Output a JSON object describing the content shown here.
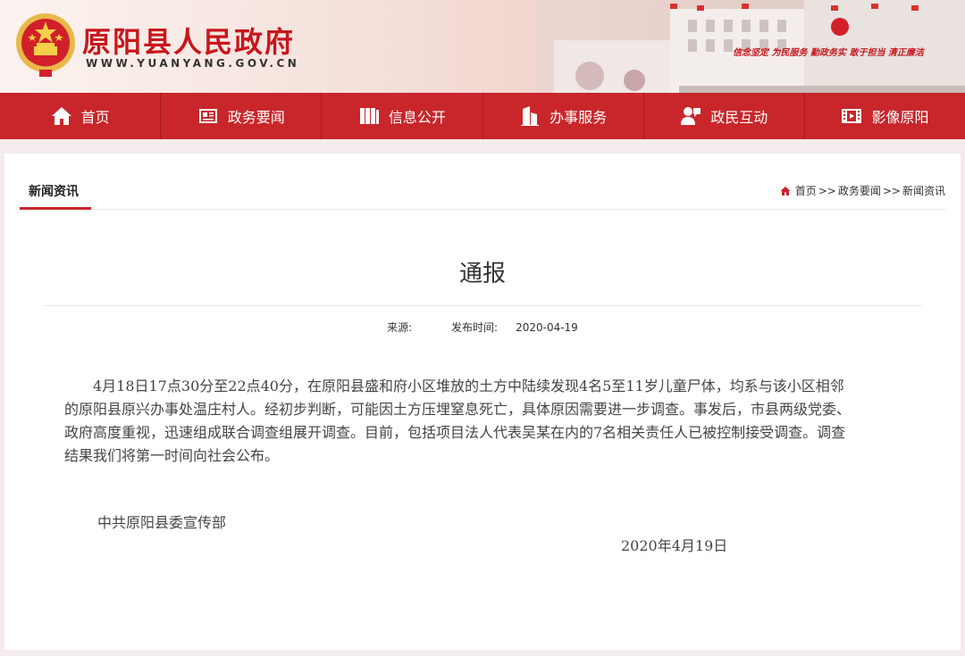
{
  "header": {
    "site_title": "原阳县人民政府",
    "site_url": "WWW.YUANYANG.GOV.CN",
    "slogan": "信念坚定  为民服务  勤政务实  敢于担当  清正廉洁"
  },
  "nav": {
    "items": [
      {
        "label": "首页",
        "icon": "home-icon"
      },
      {
        "label": "政务要闻",
        "icon": "newspaper-icon"
      },
      {
        "label": "信息公开",
        "icon": "books-icon"
      },
      {
        "label": "办事服务",
        "icon": "building-icon"
      },
      {
        "label": "政民互动",
        "icon": "user-chat-icon"
      },
      {
        "label": "影像原阳",
        "icon": "film-icon"
      }
    ]
  },
  "section": {
    "tab_label": "新闻资讯",
    "breadcrumb": [
      "首页",
      "政务要闻",
      "新闻资讯"
    ],
    "breadcrumb_sep": ">>"
  },
  "article": {
    "title": "通报",
    "source_label": "来源:",
    "source_value": "",
    "date_label": "发布时间:",
    "date_value": "2020-04-19",
    "body": "4月18日17点30分至22点40分，在原阳县盛和府小区堆放的土方中陆续发现4名5至11岁儿童尸体，均系与该小区相邻的原阳县原兴办事处温庄村人。经初步判断，可能因土方压埋窒息死亡，具体原因需要进一步调查。事发后，市县两级党委、政府高度重视，迅速组成联合调查组展开调查。目前，包括项目法人代表吴某在内的7名相关责任人已被控制接受调查。调查结果我们将第一时间向社会公布。",
    "sign_org": "中共原阳县委宣传部",
    "sign_date": "2020年4月19日"
  },
  "colors": {
    "brand_red": "#c8262b",
    "title_red": "#c8161d",
    "page_bg": "#f4ecec"
  }
}
